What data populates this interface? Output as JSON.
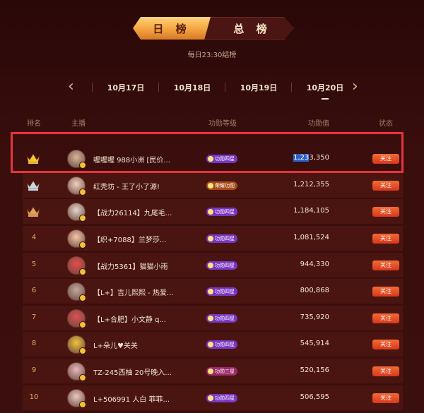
{
  "tabs": {
    "day": "日 榜",
    "total": "总 榜"
  },
  "subtitle": "每日23:30结榜",
  "dates": [
    "10月17日",
    "10月18日",
    "10月19日",
    "10月20日"
  ],
  "header": {
    "rank": "排名",
    "anchor": "主播",
    "level": "功勋等级",
    "value": "功勋值",
    "follow": "状态"
  },
  "follow_label": "关注",
  "rows": [
    {
      "rank": "",
      "crown": "gold",
      "name": "喔喔喔 988小洲 [民价...",
      "level": "功勋四星",
      "level_color": "#7a36c2",
      "value": "1,233,350"
    },
    {
      "rank": "",
      "crown": "silver",
      "name": "红秃坊 - 王了小了源!",
      "level": "荣耀功勋",
      "level_color": "#a84a16",
      "value": "1,212,355"
    },
    {
      "rank": "",
      "crown": "bronze",
      "name": "【战力26114】九尾毛...",
      "level": "功勋四星",
      "level_color": "#7a36c2",
      "value": "1,184,105"
    },
    {
      "rank": "4",
      "crown": "",
      "name": "【织+7088】兰梦莎...",
      "level": "功勋四星",
      "level_color": "#7a36c2",
      "value": "1,081,524"
    },
    {
      "rank": "5",
      "crown": "",
      "name": "【战力5361】猫猫小雨",
      "level": "功勋四星",
      "level_color": "#7a36c2",
      "value": "944,330"
    },
    {
      "rank": "6",
      "crown": "",
      "name": "【L+】吉儿熙熙 - 热爱...",
      "level": "功勋四星",
      "level_color": "#7a36c2",
      "value": "800,868"
    },
    {
      "rank": "7",
      "crown": "",
      "name": "【L+合肥】小文静 q...",
      "level": "功勋四星",
      "level_color": "#7a36c2",
      "value": "735,920"
    },
    {
      "rank": "8",
      "crown": "",
      "name": "L+朵儿♥关关",
      "level": "功勋四星",
      "level_color": "#7a36c2",
      "value": "545,914"
    },
    {
      "rank": "9",
      "crown": "",
      "name": "TZ-245西柚 20号晚入...",
      "level": "功勋三星",
      "level_color": "#9a2a6a",
      "value": "520,156"
    },
    {
      "rank": "10",
      "crown": "",
      "name": "L+506991 人白 菲菲...",
      "level": "功勋四星",
      "level_color": "#7a36c2",
      "value": "506,595"
    }
  ],
  "colors": {
    "gold": "#f4c63a",
    "silver": "#c9d6e6",
    "bronze": "#e0a060",
    "accent": "#e8333b"
  }
}
